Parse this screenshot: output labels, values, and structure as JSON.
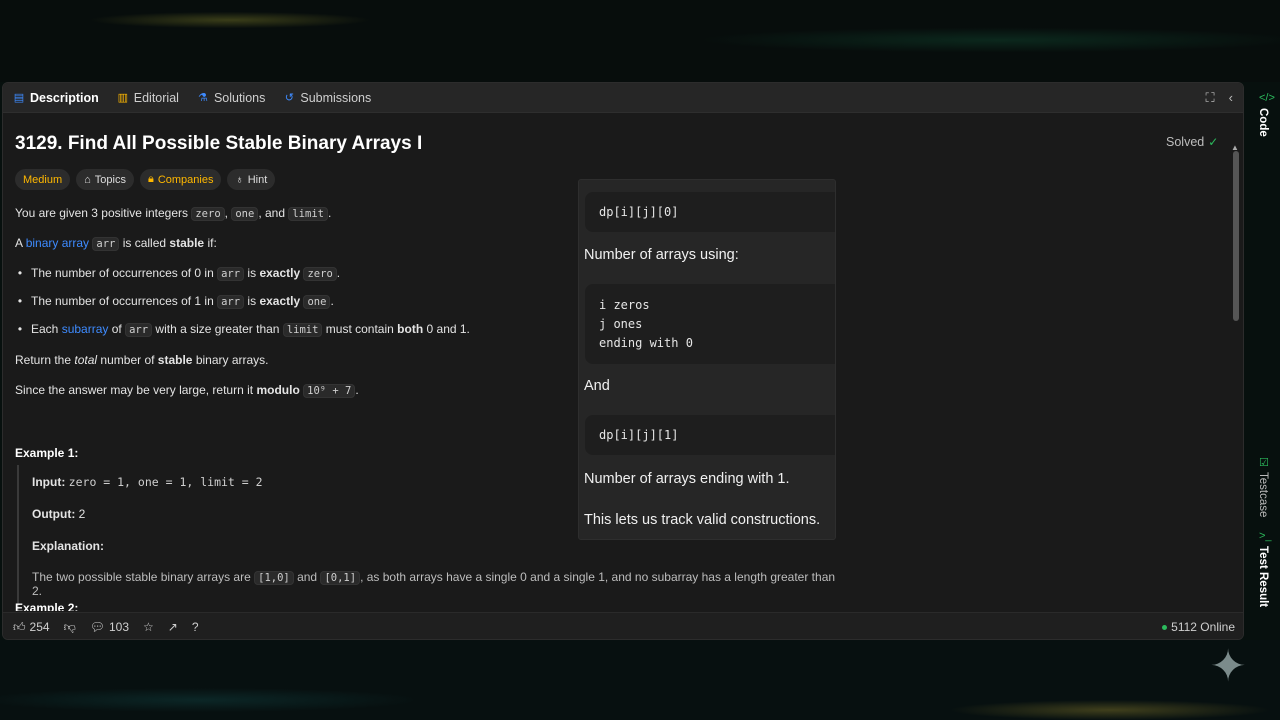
{
  "tabs": [
    {
      "label": "Description",
      "icon": "document-icon"
    },
    {
      "label": "Editorial",
      "icon": "book-icon"
    },
    {
      "label": "Solutions",
      "icon": "flask-icon"
    },
    {
      "label": "Submissions",
      "icon": "history-icon"
    }
  ],
  "problem": {
    "title": "3129. Find All Possible Stable Binary Arrays I",
    "status": "Solved",
    "tags": {
      "difficulty": "Medium",
      "topics": "Topics",
      "companies": "Companies",
      "hint": "Hint"
    },
    "intro": {
      "t1": "You are given 3 positive integers",
      "c1": "zero",
      "t2": ",",
      "c2": "one",
      "t3": ", and",
      "c3": "limit",
      "t4": "."
    },
    "stable_def": {
      "t1": "A",
      "link": "binary array",
      "c1": "arr",
      "t2": "is called",
      "b1": "stable",
      "t3": "if:"
    },
    "bullet1": {
      "t1": "The number of occurrences of 0 in",
      "c1": "arr",
      "t2": "is",
      "b1": "exactly",
      "c2": "zero",
      "t3": "."
    },
    "bullet2": {
      "t1": "The number of occurrences of 1 in",
      "c1": "arr",
      "t2": "is",
      "b1": "exactly",
      "c2": "one",
      "t3": "."
    },
    "bullet3": {
      "t1": "Each",
      "link": "subarray",
      "t2": "of",
      "c1": "arr",
      "t3": "with a size greater than",
      "c2": "limit",
      "t4": "must contain",
      "b1": "both",
      "t5": "0 and 1."
    },
    "return_line": {
      "t1": "Return the",
      "i1": "total",
      "t2": "number of",
      "b1": "stable",
      "t3": "binary arrays."
    },
    "modulo_line": {
      "t1": "Since the answer may be very large, return it",
      "b1": "modulo",
      "c1": "10⁹ + 7",
      "t2": "."
    },
    "example1": {
      "heading": "Example 1:",
      "input_label": "Input:",
      "input_value": "zero = 1, one = 1, limit = 2",
      "output_label": "Output:",
      "output_value": "2",
      "explanation_label": "Explanation:",
      "explanation": {
        "t1": "The two possible stable binary arrays are",
        "c1": "[1,0]",
        "t2": "and",
        "c2": "[0,1]",
        "t3": ", as both arrays have a single 0 and a single 1, and no subarray has a length greater than 2."
      }
    },
    "example2_heading": "Example 2:"
  },
  "overlay": {
    "code1": "dp[i][j][0]",
    "text1": "Number of arrays using:",
    "code2": "i zeros\nj ones\nending with 0",
    "text2": "And",
    "code3": "dp[i][j][1]",
    "text3": "Number of arrays ending with 1.",
    "text4": "This lets us track valid constructions."
  },
  "footer": {
    "likes": "254",
    "comments": "103",
    "online": "5112 Online"
  },
  "sidebar": {
    "code": "Code",
    "testcase": "Testcase",
    "test_result": "Test Result"
  }
}
